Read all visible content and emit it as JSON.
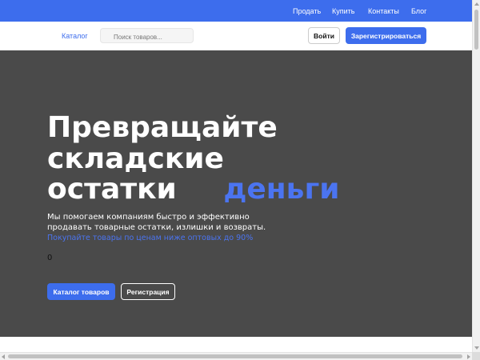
{
  "topbar": {
    "links": [
      "Продать",
      "Купить",
      "Контакты",
      "Блог"
    ]
  },
  "header": {
    "catalog_label": "Каталог",
    "search_placeholder": "Поиск товаров...",
    "login_label": "Войти",
    "register_label": "Зарегистрироваться"
  },
  "hero": {
    "title_line1": "Превращайте",
    "title_line2": "складские",
    "title_line3": "остатки",
    "title_accent": "деньги",
    "desc_line1": "Мы помогаем компаниям быстро и эффективно",
    "desc_line2": "продавать товарные остатки, излишки и возвраты.",
    "promo": "Покупайте товары по ценам ниже оптовых до 90%",
    "counter": "0",
    "catalog_button": "Каталог товаров",
    "register_button": "Регистрация"
  },
  "colors": {
    "brand": "#3d6ded",
    "hero_bg": "#4a4a4a"
  }
}
